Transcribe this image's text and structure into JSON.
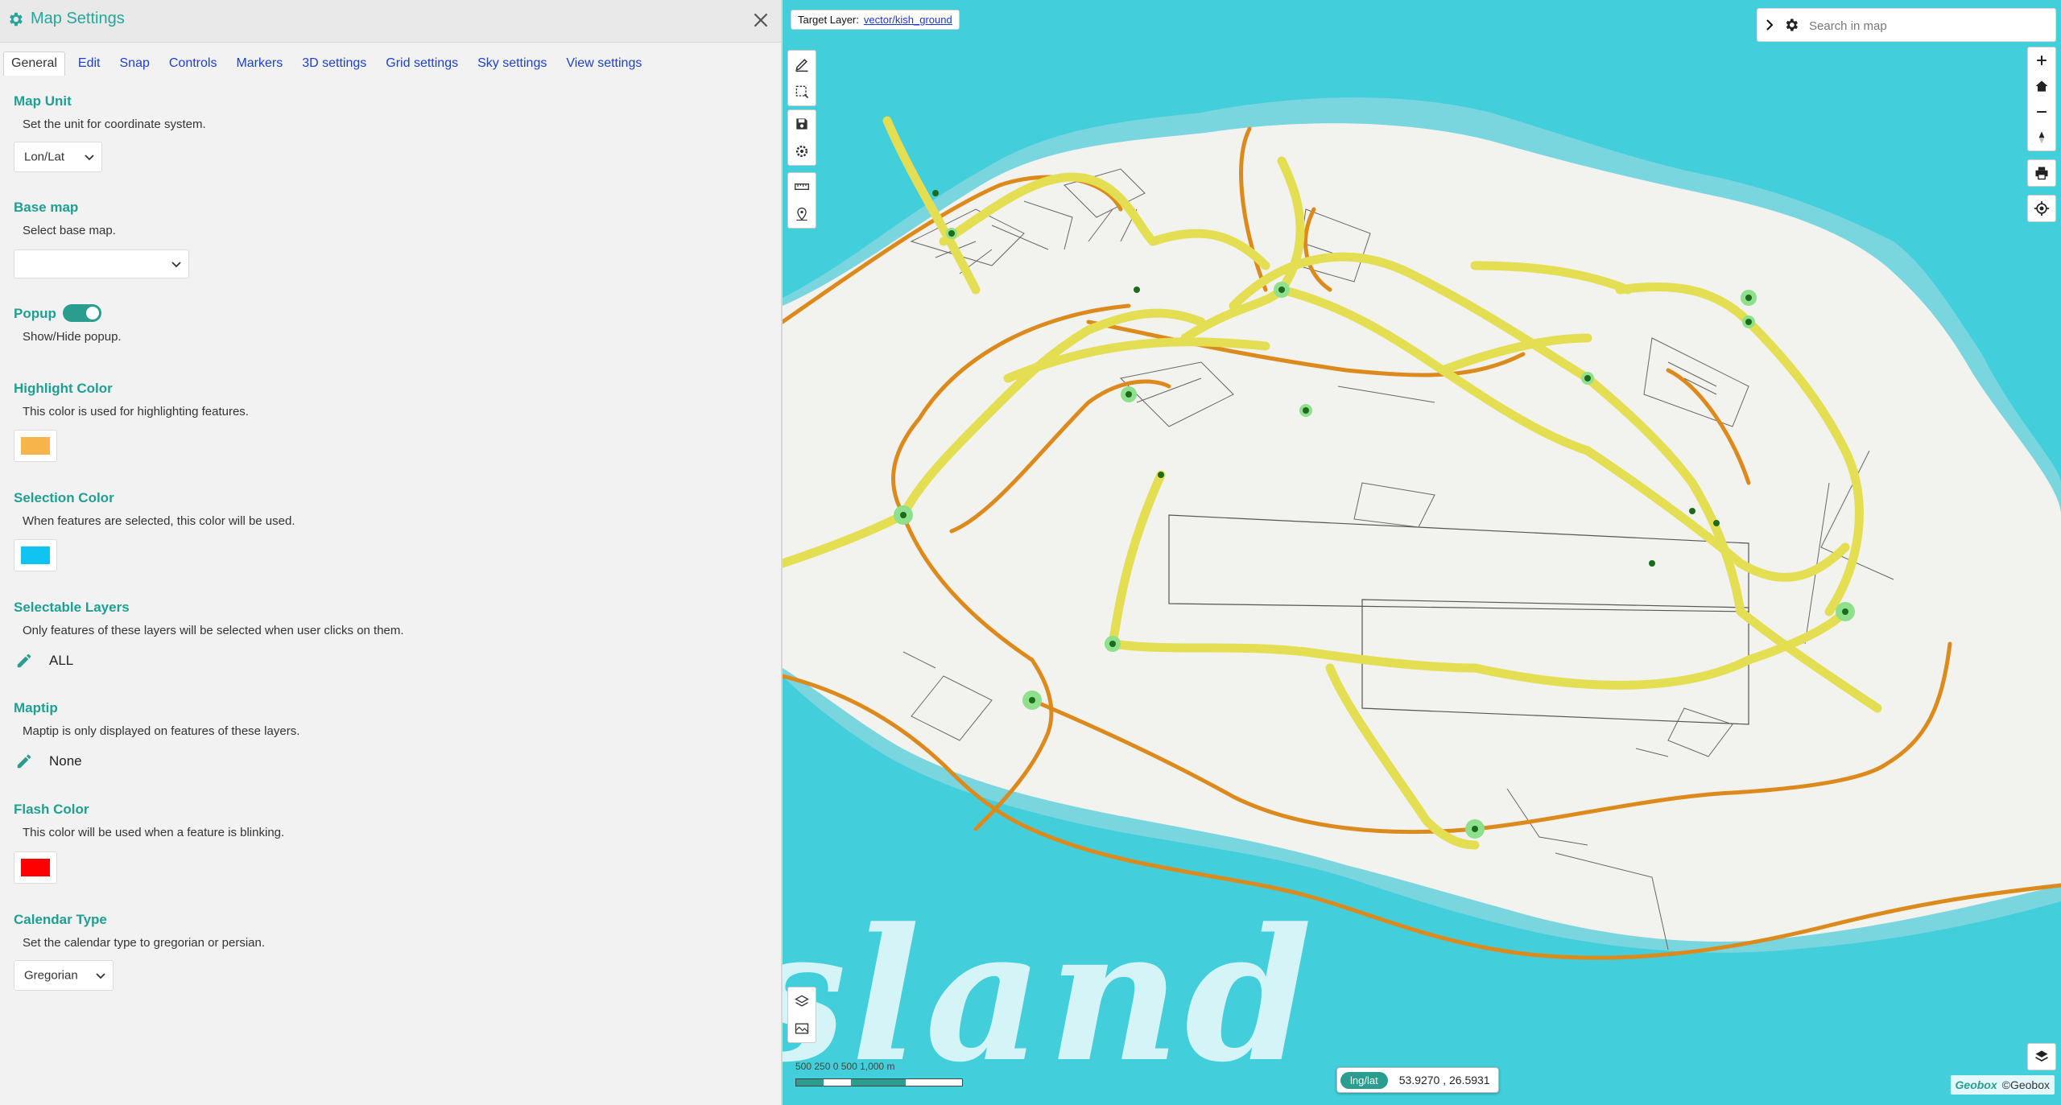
{
  "panel": {
    "title": "Map Settings",
    "tabs": [
      {
        "label": "General",
        "active": true
      },
      {
        "label": "Edit"
      },
      {
        "label": "Snap"
      },
      {
        "label": "Controls"
      },
      {
        "label": "Markers"
      },
      {
        "label": "3D settings"
      },
      {
        "label": "Grid settings"
      },
      {
        "label": "Sky settings"
      },
      {
        "label": "View settings"
      }
    ],
    "map_unit": {
      "title": "Map Unit",
      "desc": "Set the unit for coordinate system.",
      "value": "Lon/Lat"
    },
    "base_map": {
      "title": "Base map",
      "desc": "Select base map.",
      "value": ""
    },
    "popup": {
      "title": "Popup",
      "desc": "Show/Hide popup.",
      "enabled": true
    },
    "highlight_color": {
      "title": "Highlight Color",
      "desc": "This color is used for highlighting features.",
      "color": "#f7b44a"
    },
    "selection_color": {
      "title": "Selection Color",
      "desc": "When features are selected, this color will be used.",
      "color": "#0fc4f0"
    },
    "selectable_layers": {
      "title": "Selectable Layers",
      "desc": "Only features of these layers will be selected when user clicks on them.",
      "value": "ALL"
    },
    "maptip": {
      "title": "Maptip",
      "desc": "Maptip is only displayed on features of these layers.",
      "value": "None"
    },
    "flash_color": {
      "title": "Flash Color",
      "desc": "This color will be used when a feature is blinking.",
      "color": "#ff0000"
    },
    "calendar_type": {
      "title": "Calendar Type",
      "desc": "Set the calendar type to gregorian or persian.",
      "value": "Gregorian"
    }
  },
  "map": {
    "target_layer_label": "Target Layer:",
    "target_layer_value": "vector/kish_ground",
    "search_placeholder": "Search in map",
    "map_text": "sland",
    "scale": {
      "labels": "500  250  0         500        1,000 m"
    },
    "coords": {
      "unit": "lng/lat",
      "value": "53.9270 , 26.5931"
    },
    "logo_brand": "Geobox",
    "logo_text": "©Geobox",
    "colors": {
      "water": "#42cedb",
      "land": "#f2f2ee",
      "highway": "#e4de52",
      "arterial": "#dd8a1c",
      "accent": "#2a9d8f"
    },
    "icons_left_top": [
      "pencil-icon",
      "select-box-icon",
      "save-icon",
      "settings-icon",
      "ruler-icon",
      "location-pin-icon"
    ],
    "icons_right": [
      "zoom-in-icon",
      "home-icon",
      "zoom-out-icon",
      "compass-icon",
      "print-icon",
      "locate-icon"
    ],
    "icons_bottom": [
      "layers-icon",
      "basemap-icon",
      "layers-switch-icon"
    ]
  }
}
